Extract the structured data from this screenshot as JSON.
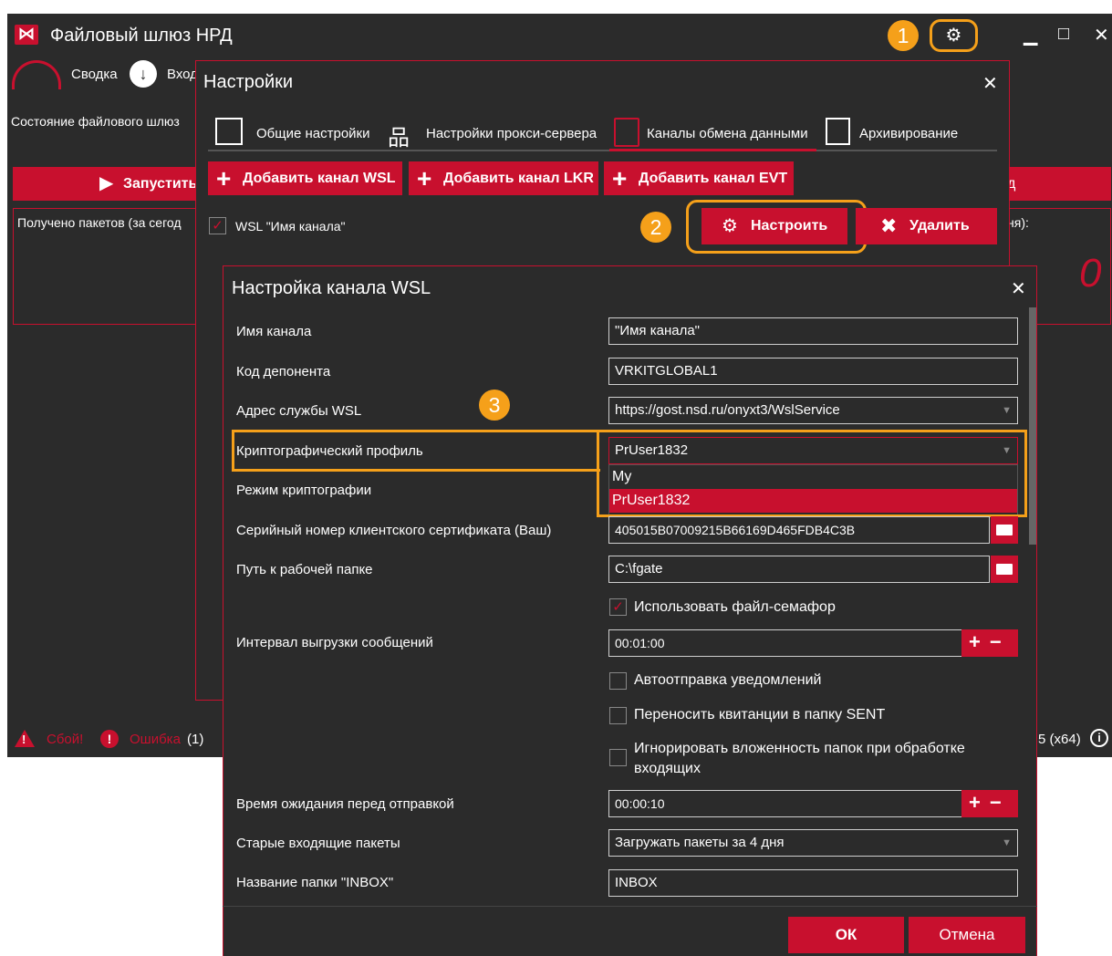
{
  "app": {
    "title": "Файловый шлюз НРД",
    "gear_icon": "gear-icon",
    "step1": "1",
    "minimize": "▁",
    "maximize": "□",
    "close": "✕"
  },
  "nav": {
    "summary": "Сводка",
    "incoming": "Вход"
  },
  "main": {
    "status_label": "Состояние файлового шлюз",
    "start_label": "Запустить",
    "start_right": "д",
    "packets_label": "Получено пакетов (за сегод",
    "packets_right_label": "ня):",
    "packets_count": "0"
  },
  "bottom": {
    "fail": "Сбой!",
    "error": "Ошибка",
    "error_count": "(1)",
    "version": "5 (x64)"
  },
  "settings": {
    "title": "Настройки",
    "tabs": [
      "Общие настройки",
      "Настройки прокси-сервера",
      "Каналы обмена данными",
      "Архивирование"
    ],
    "add_wsl": "Добавить канал WSL",
    "add_lkr": "Добавить канал LKR",
    "add_evt": "Добавить канал EVT",
    "channel_label": "WSL \"Имя канала\"",
    "configure": "Настроить",
    "delete": "Удалить",
    "step2": "2"
  },
  "wsl": {
    "title": "Настройка канала WSL",
    "step3": "3",
    "fields": {
      "channel_name_label": "Имя канала",
      "channel_name_value": "\"Имя канала\"",
      "depo_code_label": "Код депонента",
      "depo_code_value": "VRKITGLOBAL1",
      "service_label": "Адрес службы WSL",
      "service_value": "https://gost.nsd.ru/onyxt3/WslService",
      "crypto_profile_label": "Криптографический профиль",
      "crypto_profile_value": "PrUser1832",
      "crypto_mode_label": "Режим криптографии",
      "serial_label": "Серийный номер клиентского сертификата (Ваш)",
      "serial_value": "405015B07009215B66169D465FDB4C3B",
      "path_label": "Путь к рабочей папке",
      "path_value": "C:\\fgate",
      "semaphore_label": "Использовать файл-семафор",
      "interval_label": "Интервал выгрузки сообщений",
      "interval_value": "00:01:00",
      "auto_notify_label": "Автоотправка уведомлений",
      "move_receipts_label": "Переносить квитанции в папку SENT",
      "ignore_nesting_label_1": "Игнорировать вложенность папок при обработке",
      "ignore_nesting_label_2": "входящих",
      "wait_label": "Время ожидания перед отправкой",
      "wait_value": "00:00:10",
      "old_packets_label": "Старые входящие пакеты",
      "old_packets_value": "Загружать пакеты за 4 дня",
      "inbox_label": "Название папки \"INBOX\"",
      "inbox_value": "INBOX"
    },
    "dropdown_options": [
      "My",
      "PrUser1832"
    ],
    "ok": "ОК",
    "cancel": "Отмена"
  }
}
